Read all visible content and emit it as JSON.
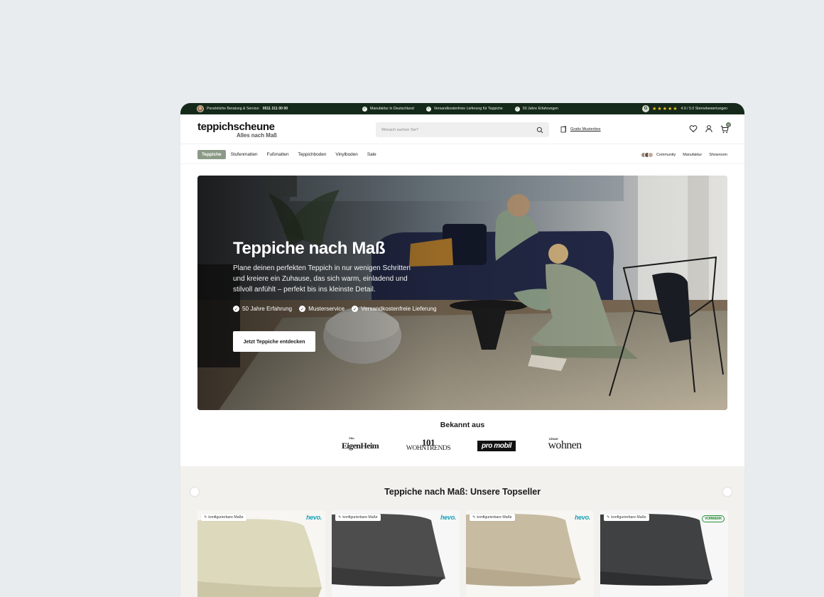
{
  "topbar": {
    "service_prefix": "Persönliche Beratung & Service:",
    "service_phone": "0511 211 00 00",
    "usps": [
      "Manufaktur in Deutschland",
      "Versandkostenfreie Lieferung für Teppiche",
      "50 Jahre Erfahrungen"
    ],
    "rating_text": "4.9 / 5.0 Sternebewertungen",
    "rating_badge": "G",
    "stars": "★★★★★"
  },
  "header": {
    "brand": "teppichscheune",
    "claim": "Alles nach Maß",
    "search_placeholder": "Wonach suchen Sie?",
    "musterbox_label": "Gratis Musterbox",
    "cart_count": "0"
  },
  "nav": {
    "items": [
      "Teppiche",
      "Stufenmatten",
      "Fußmatten",
      "Teppichboden",
      "Vinylboden",
      "Sale"
    ],
    "right_items": [
      "Community",
      "Manufaktur",
      "Showroom"
    ]
  },
  "hero": {
    "title": "Teppiche nach Maß",
    "text": "Plane deinen perfekten Teppich in nur wenigen Schritten und kreiere ein Zuhause, das sich warm, einladend und stilvoll anfühlt – perfekt bis ins kleinste Detail.",
    "usps": [
      "50 Jahre Erfahrung",
      "Musterservice",
      "Versandkostenfreie Lieferung"
    ],
    "cta": "Jetzt Teppiche entdecken"
  },
  "press": {
    "title": "Bekannt aus",
    "logos": {
      "eigenheim_top": "Mein",
      "eigenheim": "EigenHeim",
      "wohntrends_num": "101",
      "wohntrends": "WOHNTRENDS",
      "promobil": "pro mobil",
      "wohnen_top": "zuhause",
      "wohnen": "wohnen"
    }
  },
  "topseller": {
    "title": "Teppiche nach Maß: Unsere Topseller",
    "cards": [
      {
        "tag": "konfigurierbare Maße",
        "brand": "hevo."
      },
      {
        "tag": "konfigurierbare Maße",
        "brand": "hevo."
      },
      {
        "tag": "konfigurierbare Maße",
        "brand": "hevo."
      },
      {
        "tag": "konfigurierbare Maße",
        "brand": "VORWERK"
      }
    ]
  },
  "colors": {
    "topbar_bg": "#15291a",
    "nav_active": "#8b9a86",
    "page_bg": "#e9ecee",
    "section_bg": "#f2f1ee"
  }
}
